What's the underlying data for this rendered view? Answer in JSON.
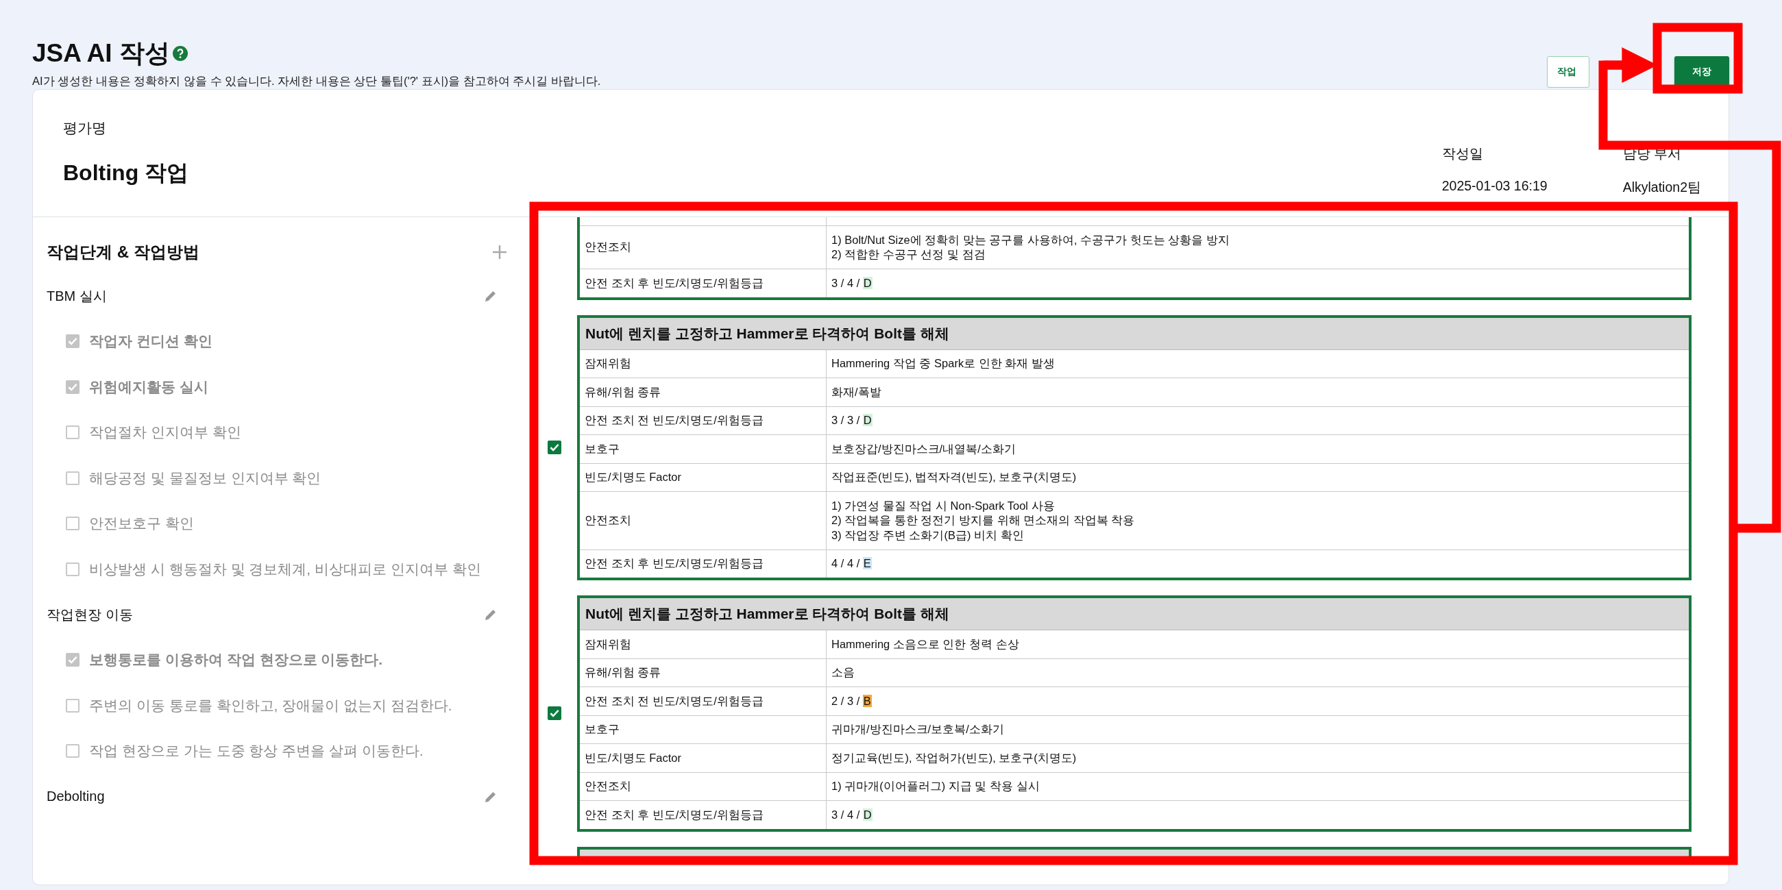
{
  "page": {
    "title": "JSA AI 작성",
    "notice": "AI가 생성한 내용은 정확하지 않을 수 있습니다. 자세한 내용은 상단 툴팁('?' 표시)을 참고하여 주시길 바랍니다."
  },
  "buttons": [
    {
      "label": "작업",
      "kind": "outline"
    },
    {
      "label": "저장",
      "kind": "primary"
    }
  ],
  "assessment": {
    "name_label": "평가명",
    "name": "Bolting 작업",
    "fields": [
      {
        "label": "작성일",
        "value": "2025-01-03 16:19"
      },
      {
        "label": "담당 부서",
        "value": "Alkylation2팀"
      }
    ]
  },
  "sidebar": {
    "title": "작업단계 & 작업방법",
    "groups": [
      {
        "name": "TBM 실시",
        "items": [
          {
            "label": "작업자 컨디션 확인",
            "checked": true
          },
          {
            "label": "위험예지활동 실시",
            "checked": true
          },
          {
            "label": "작업절차 인지여부 확인",
            "checked": false
          },
          {
            "label": "해당공정 및 물질정보 인지여부 확인",
            "checked": false
          },
          {
            "label": "안전보호구 확인",
            "checked": false
          },
          {
            "label": "비상발생 시 행동절차 및 경보체계, 비상대피로 인지여부 확인",
            "checked": false
          }
        ]
      },
      {
        "name": "작업현장 이동",
        "items": [
          {
            "label": "보행통로를 이용하여 작업 현장으로 이동한다.",
            "checked": true
          },
          {
            "label": "주변의 이동 통로를 확인하고, 장애물이 없는지 점검한다.",
            "checked": false
          },
          {
            "label": "작업 현장으로 가는 도중 항상 주변을 살펴 이동한다.",
            "checked": false
          }
        ]
      },
      {
        "name": "Debolting"
      }
    ]
  },
  "hazards": [
    {
      "kind": "partial",
      "rows": [
        {
          "label": "안전조치",
          "value": "1) Bolt/Nut Size에 정확히 맞는 공구를 사용하여, 수공구가 헛도는 상황을 방지\n2) 적합한 수공구 선정 및 점검"
        },
        {
          "label": "안전 조치 후 빈도/치명도/위험등급",
          "value": "3 / 4 / ",
          "grade": "D",
          "color": "#d3f1dc"
        }
      ]
    },
    {
      "kind": "full",
      "checked": true,
      "heading": "Nut에 렌치를 고정하고 Hammer로 타격하여 Bolt를 해체",
      "rows": [
        {
          "label": "잠재위험",
          "value": "Hammering 작업 중 Spark로 인한 화재 발생"
        },
        {
          "label": "유해/위험 종류",
          "value": "화재/폭발"
        },
        {
          "label": "안전 조치 전 빈도/치명도/위험등급",
          "value": "3 / 3 / ",
          "grade": "D",
          "color": "#d3f1dc"
        },
        {
          "label": "보호구",
          "value": "보호장갑/방진마스크/내열복/소화기"
        },
        {
          "label": "빈도/치명도 Factor",
          "value": "작업표준(빈도), 법적자격(빈도), 보호구(치명도)"
        },
        {
          "label": "안전조치",
          "value": "1) 가연성 물질 작업 시 Non-Spark Tool 사용\n2) 작업복을 통한 정전기 방지를 위해 면소재의 작업복 착용\n3) 작업장 주변 소화기(B급) 비치 확인"
        },
        {
          "label": "안전 조치 후 빈도/치명도/위험등급",
          "value": "4 / 4 / ",
          "grade": "E",
          "color": "#cce6f6"
        }
      ]
    },
    {
      "kind": "full",
      "checked": true,
      "heading": "Nut에 렌치를 고정하고 Hammer로 타격하여 Bolt를 해체",
      "rows": [
        {
          "label": "잠재위험",
          "value": "Hammering 소음으로 인한 청력 손상"
        },
        {
          "label": "유해/위험 종류",
          "value": "소음"
        },
        {
          "label": "안전 조치 전 빈도/치명도/위험등급",
          "value": "2 / 3 / ",
          "grade": "B",
          "color": "#f4a63c"
        },
        {
          "label": "보호구",
          "value": "귀마개/방진마스크/보호복/소화기"
        },
        {
          "label": "빈도/치명도 Factor",
          "value": "정기교육(빈도), 작업허가(빈도), 보호구(치명도)"
        },
        {
          "label": "안전조치",
          "value": "1) 귀마개(이어플러그) 지급 및 착용 실시"
        },
        {
          "label": "안전 조치 후 빈도/치명도/위험등급",
          "value": "3 / 4 / ",
          "grade": "D",
          "color": "#d3f1dc"
        }
      ]
    },
    {
      "kind": "cut"
    }
  ]
}
